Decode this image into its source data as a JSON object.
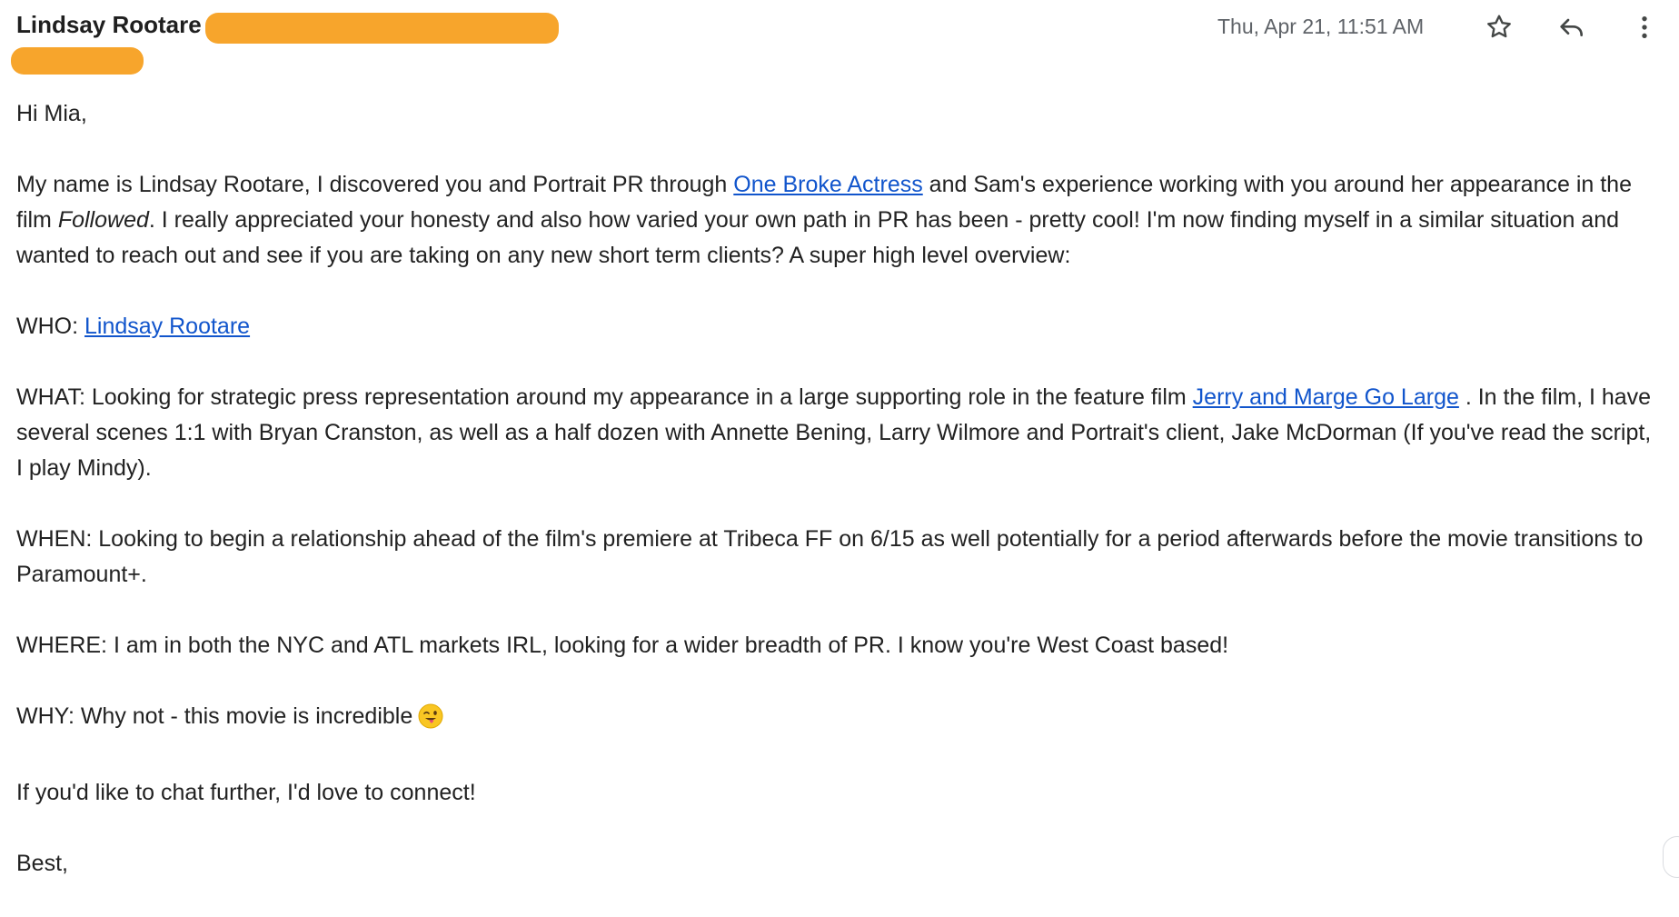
{
  "email": {
    "sender_name": "Lindsay Rootare",
    "timestamp": "Thu, Apr 21, 11:51 AM"
  },
  "icons": {
    "star": "star-outline-icon",
    "reply": "reply-arrow-icon",
    "more": "vertical-dots-icon",
    "emoji": "winking-face-with-tongue"
  },
  "colors": {
    "link": "#1155cc",
    "redaction": "#f7a52c",
    "meta_text": "#5f6368"
  },
  "body": {
    "greeting": "Hi Mia,",
    "p1": {
      "t1": "My name is Lindsay Rootare, I discovered you and Portrait PR through ",
      "link": "One Broke Actress",
      "t2": " and Sam's experience working with you around her appearance in the film ",
      "italic": "Followed",
      "t3": ". I really appreciated your honesty and also how varied your own path in PR has been - pretty cool! I'm now finding myself in a similar situation and wanted to reach out and see if you are taking on any new short term clients? A super high level overview:"
    },
    "who": {
      "label": "WHO: ",
      "link": "Lindsay Rootare"
    },
    "what": {
      "t1": "WHAT: Looking for strategic press representation around my appearance in a large supporting role in the feature film ",
      "link": "Jerry and Marge Go Large",
      "t2": " . In the film, I have several scenes 1:1 with Bryan Cranston, as well as a half dozen with Annette Bening, Larry Wilmore and Portrait's client, Jake McDorman (If you've read the script, I play Mindy)."
    },
    "when": "WHEN: Looking to begin a relationship ahead of the film's premiere at Tribeca FF on 6/15 as well potentially for a period afterwards before the movie transitions to Paramount+.",
    "where": "WHERE: I am in both the NYC and ATL markets IRL, looking for a wider breadth of PR. I know you're West Coast based!",
    "why": "WHY: Why not - this movie is incredible",
    "closing": "If you'd like to chat further, I'd love to connect!",
    "signoff": "Best,"
  }
}
